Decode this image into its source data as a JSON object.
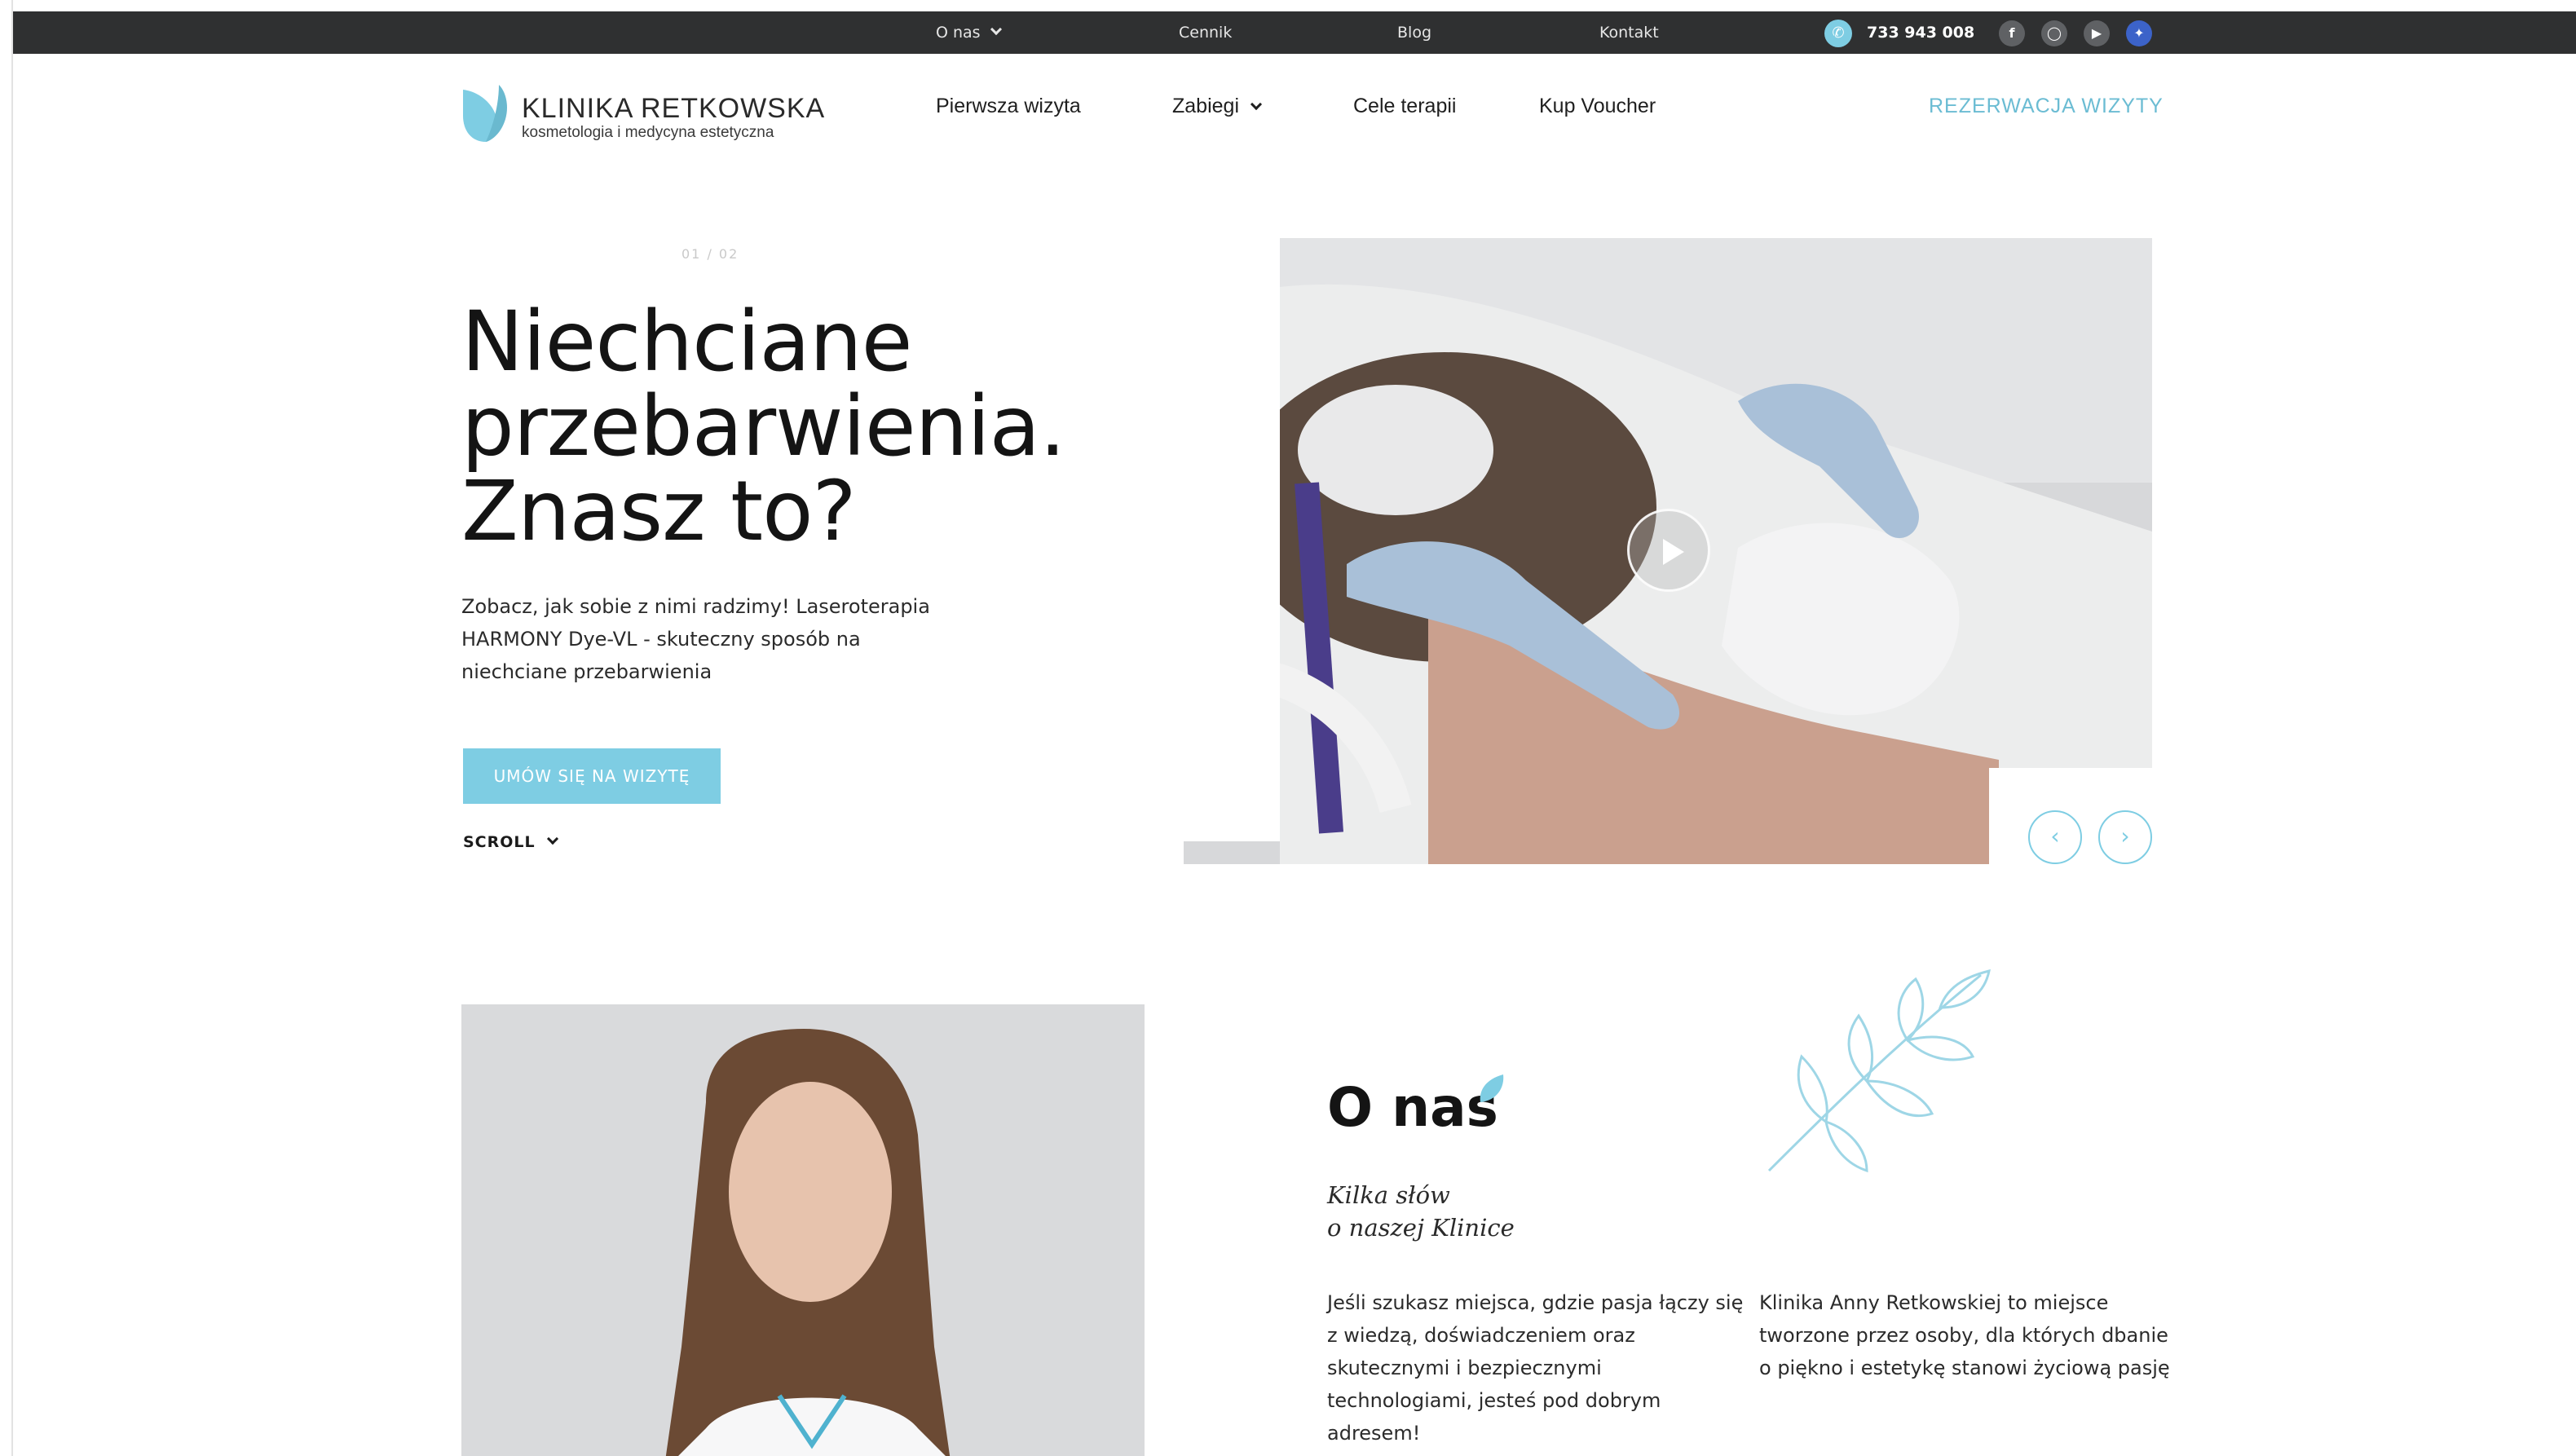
{
  "topbar": {
    "about_label": "O nas",
    "pricing_label": "Cennik",
    "blog_label": "Blog",
    "contact_label": "Kontakt",
    "phone": "733 943 008",
    "socials": [
      "facebook-icon",
      "instagram-icon",
      "youtube-icon",
      "language-flag-icon"
    ]
  },
  "logo": {
    "title": "KLINIKA RETKOWSKA",
    "subtitle": "kosmetologia i medycyna estetyczna"
  },
  "nav": {
    "items": [
      {
        "label": "Pierwsza wizyta"
      },
      {
        "label": "Zabiegi"
      },
      {
        "label": "Cele terapii"
      },
      {
        "label": "Kup Voucher"
      }
    ],
    "reserve_label": "REZERWACJA WIZYTY"
  },
  "hero": {
    "slide_counter": "01 / 02",
    "title_lines": [
      "Niechciane",
      "przebarwienia.",
      "Znasz to?"
    ],
    "description": "Zobacz, jak sobie z nimi radzimy! Laseroterapia HARMONY Dye-VL - skuteczny sposób na niechciane przebarwienia",
    "cta_label": "UMÓW SIĘ NA WIZYTĘ",
    "scroll_label": "SCROLL"
  },
  "about": {
    "title": "O nas",
    "subtitle_lines": [
      "Kilka słów",
      "o naszej Klinice"
    ],
    "col1": "Jeśli szukasz miejsca, gdzie pasja łączy się z wiedzą, doświadczeniem oraz skutecznymi i bezpiecznymi technologiami, jesteś pod dobrym adresem!",
    "col2": "Klinika Anny Retkowskiej to miejsce tworzone przez osoby, dla których dbanie o piękno i estetykę stanowi życiową pasję"
  },
  "colors": {
    "accent": "#7ecde3",
    "topbar_bg": "#2f3031",
    "text": "#141414"
  }
}
